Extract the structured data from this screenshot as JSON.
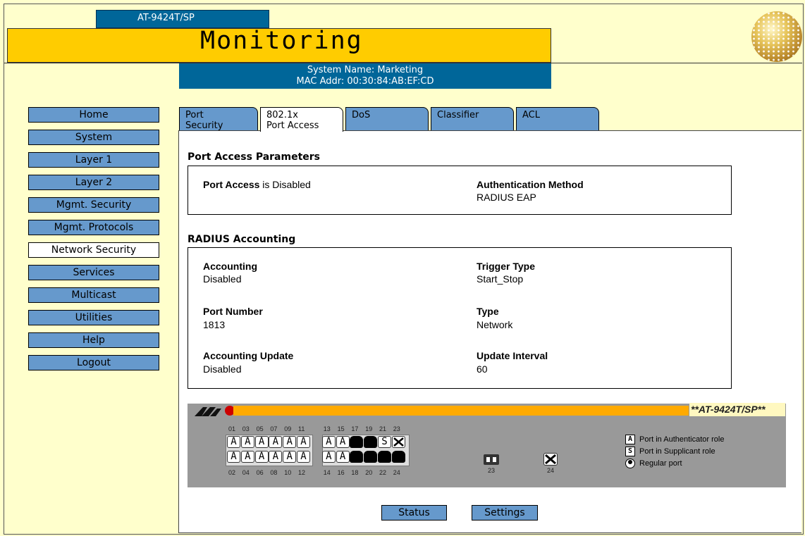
{
  "header": {
    "model_tab": "AT-9424T/SP",
    "title": "Monitoring",
    "system_name": "System Name: Marketing",
    "mac_addr": "MAC Addr: 00:30:84:AB:EF:CD"
  },
  "nav": [
    {
      "label": "Home"
    },
    {
      "label": "System"
    },
    {
      "label": "Layer 1"
    },
    {
      "label": "Layer 2"
    },
    {
      "label": "Mgmt. Security"
    },
    {
      "label": "Mgmt. Protocols"
    },
    {
      "label": "Network Security",
      "active": true
    },
    {
      "label": "Services"
    },
    {
      "label": "Multicast"
    },
    {
      "label": "Utilities"
    },
    {
      "label": "Help"
    },
    {
      "label": "Logout"
    }
  ],
  "tabs": [
    {
      "line1": "Port",
      "line2": "Security"
    },
    {
      "line1": "802.1x",
      "line2": "Port Access",
      "active": true
    },
    {
      "line1": "",
      "line2": "DoS"
    },
    {
      "line1": "",
      "line2": "Classifier"
    },
    {
      "line1": "",
      "line2": "ACL"
    }
  ],
  "port_access": {
    "section_title": "Port Access Parameters",
    "status_label": "Port Access",
    "status_text": " is Disabled",
    "auth_method_label": "Authentication Method",
    "auth_method_value": "RADIUS EAP"
  },
  "radius": {
    "section_title": "RADIUS Accounting",
    "accounting_label": "Accounting",
    "accounting_value": "Disabled",
    "trigger_label": "Trigger Type",
    "trigger_value": "Start_Stop",
    "port_label": "Port Number",
    "port_value": "1813",
    "type_label": "Type",
    "type_value": "Network",
    "update_label": "Accounting Update",
    "update_value": "Disabled",
    "interval_label": "Update Interval",
    "interval_value": "60"
  },
  "switch": {
    "model": "**AT-9424T/SP**",
    "top_numbers": [
      "01",
      "03",
      "05",
      "07",
      "09",
      "11",
      "13",
      "15",
      "17",
      "19",
      "21",
      "23"
    ],
    "bottom_numbers": [
      "02",
      "04",
      "06",
      "08",
      "10",
      "12",
      "14",
      "16",
      "18",
      "20",
      "22",
      "24"
    ],
    "top_ports": [
      "A",
      "A",
      "A",
      "A",
      "A",
      "A",
      "A",
      "A",
      "dark",
      "dark",
      "S",
      "x"
    ],
    "bottom_ports": [
      "A",
      "A",
      "A",
      "A",
      "A",
      "A",
      "A",
      "A",
      "dark",
      "dark",
      "dark",
      "dark"
    ],
    "sfp_labels": [
      "23",
      "24"
    ],
    "legend": [
      {
        "icon": "A",
        "text": "Port in Authenticator role"
      },
      {
        "icon": "S",
        "text": "Port in Supplicant role"
      },
      {
        "icon": "regular",
        "text": "Regular port"
      }
    ]
  },
  "buttons": {
    "status": "Status",
    "settings": "Settings"
  }
}
